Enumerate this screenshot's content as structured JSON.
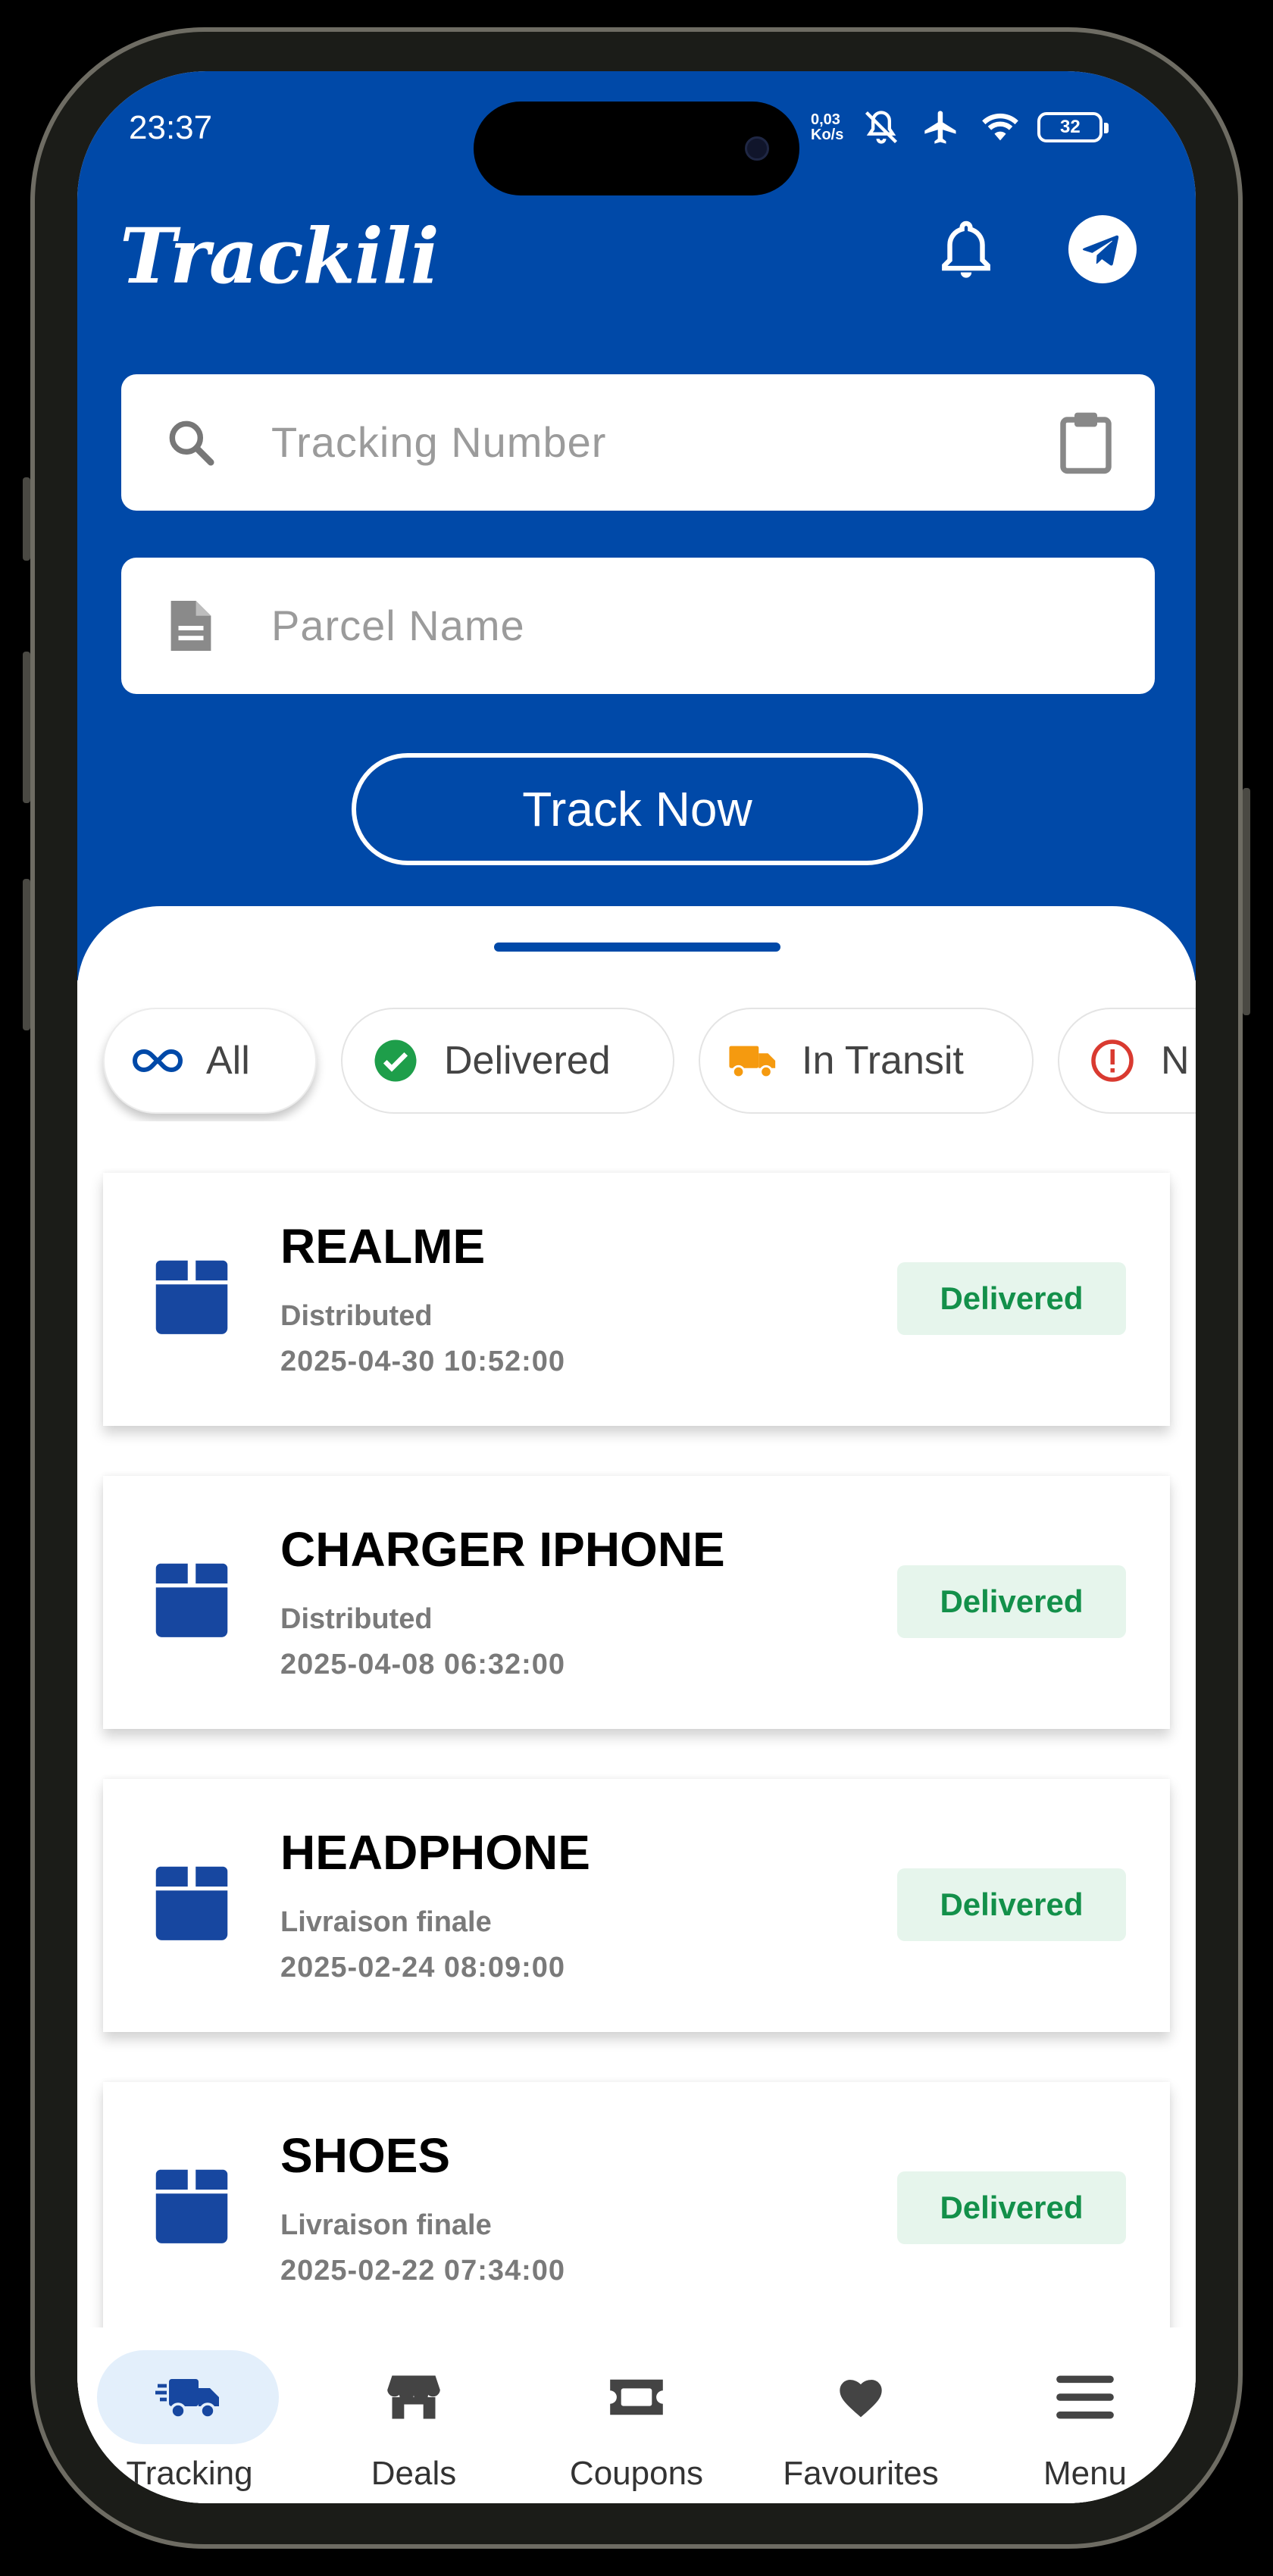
{
  "status_bar": {
    "time": "23:37",
    "net_speed_value": "0,03",
    "net_speed_unit": "Ko/s",
    "battery": "32"
  },
  "app": {
    "logo": "Trackili",
    "bell_icon": "bell-icon",
    "telegram_icon": "telegram-icon"
  },
  "form": {
    "tracking_placeholder": "Tracking Number",
    "parcel_placeholder": "Parcel Name",
    "track_button": "Track Now"
  },
  "filters": [
    {
      "label": "All",
      "icon": "infinity-icon",
      "active": true
    },
    {
      "label": "Delivered",
      "icon": "check-circle-icon",
      "active": false
    },
    {
      "label": "In Transit",
      "icon": "truck-icon",
      "active": false
    },
    {
      "label": "N",
      "icon": "alert-circle-icon",
      "active": false
    }
  ],
  "parcels": [
    {
      "name": "REALME",
      "status_text": "Distributed",
      "date": "2025-04-30 10:52:00",
      "badge": "Delivered"
    },
    {
      "name": "CHARGER IPHONE",
      "status_text": "Distributed",
      "date": "2025-04-08 06:32:00",
      "badge": "Delivered"
    },
    {
      "name": "HEADPHONE",
      "status_text": "Livraison finale",
      "date": "2025-02-24 08:09:00",
      "badge": "Delivered"
    },
    {
      "name": "SHOES",
      "status_text": "Livraison finale",
      "date": "2025-02-22 07:34:00",
      "badge": "Delivered"
    }
  ],
  "bottom_nav": [
    {
      "label": "Tracking",
      "icon": "delivery-truck-icon",
      "active": true
    },
    {
      "label": "Deals",
      "icon": "store-icon",
      "active": false
    },
    {
      "label": "Coupons",
      "icon": "coupon-icon",
      "active": false
    },
    {
      "label": "Favourites",
      "icon": "heart-icon",
      "active": false
    },
    {
      "label": "Menu",
      "icon": "hamburger-menu-icon",
      "active": false
    }
  ],
  "colors": {
    "primary": "#0049a8",
    "badge_bg": "#e6f5ec",
    "badge_text": "#13904a",
    "box_icon": "#1747a0"
  }
}
